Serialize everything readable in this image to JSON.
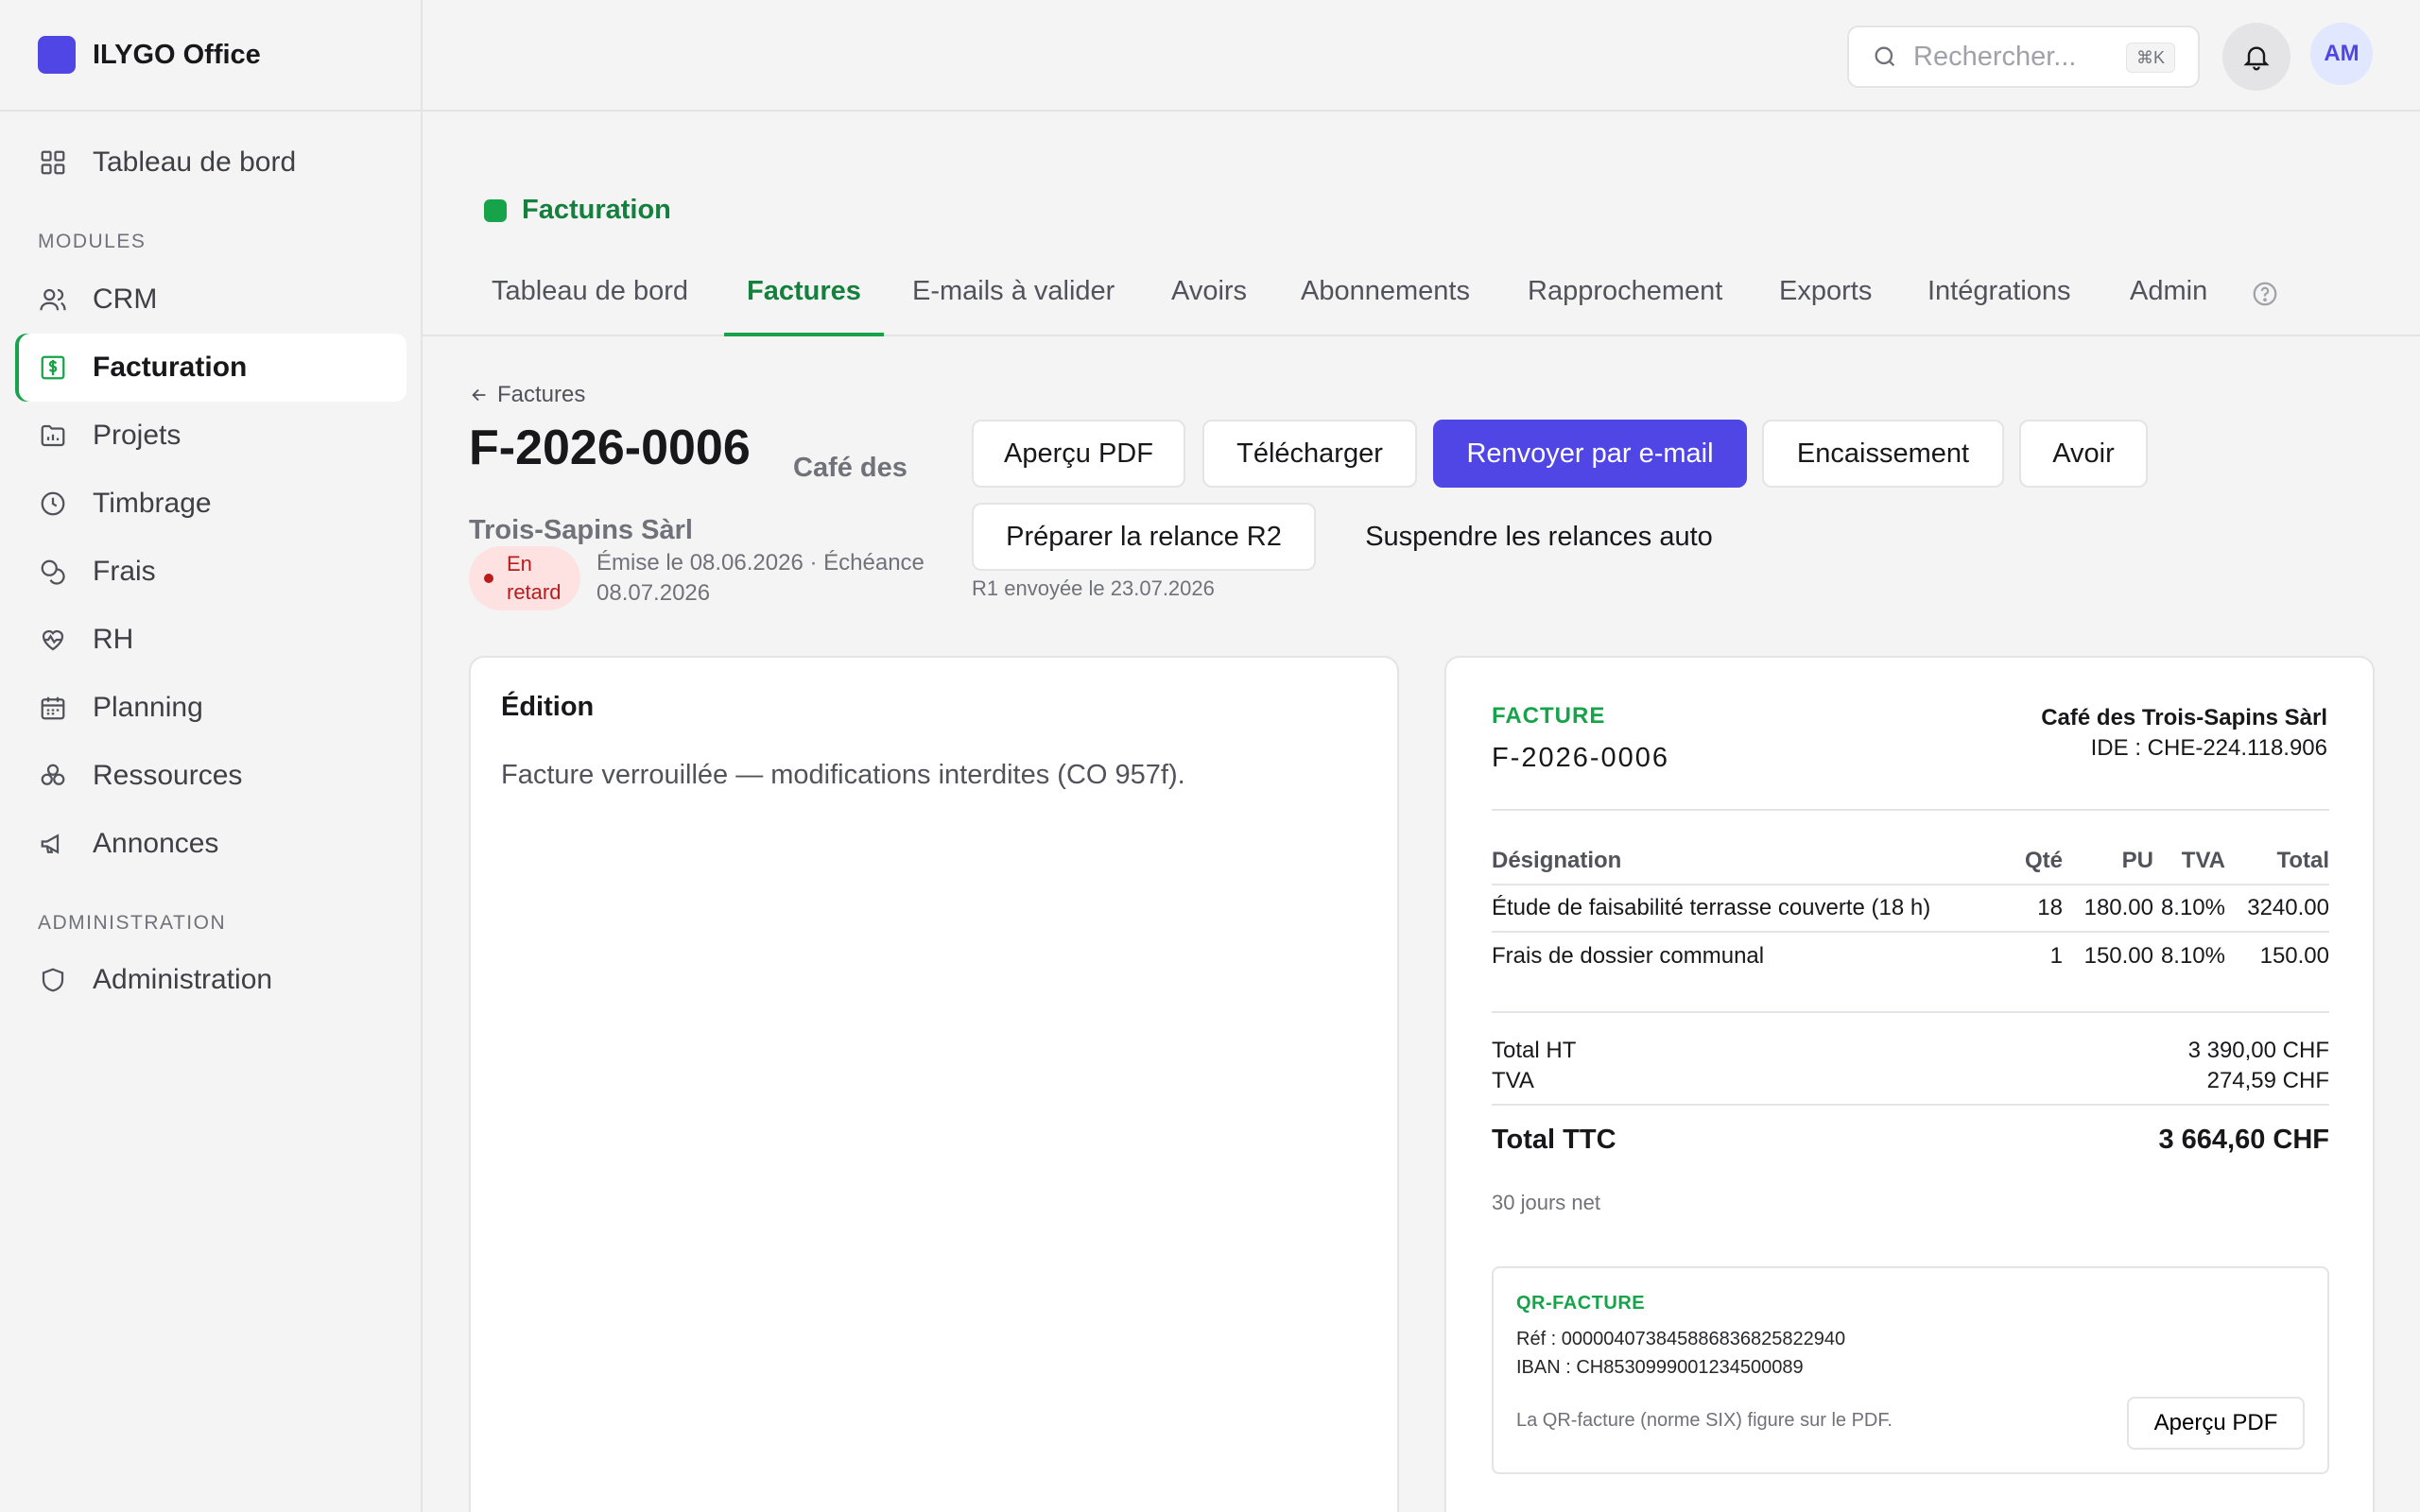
{
  "brand": {
    "name": "ILYGO Office",
    "color": "#4f46e5"
  },
  "sidebar": {
    "top_item": {
      "label": "Tableau de bord",
      "icon": "grid-icon"
    },
    "modules_label": "MODULES",
    "modules": [
      {
        "label": "CRM",
        "icon": "users-icon"
      },
      {
        "label": "Facturation",
        "icon": "invoice-icon",
        "active": true
      },
      {
        "label": "Projets",
        "icon": "folder-icon"
      },
      {
        "label": "Timbrage",
        "icon": "clock-icon"
      },
      {
        "label": "Frais",
        "icon": "coins-icon"
      },
      {
        "label": "RH",
        "icon": "heart-pulse-icon"
      },
      {
        "label": "Planning",
        "icon": "calendar-icon"
      },
      {
        "label": "Ressources",
        "icon": "boxes-icon"
      },
      {
        "label": "Annonces",
        "icon": "megaphone-icon"
      }
    ],
    "admin_label": "ADMINISTRATION",
    "admin_items": [
      {
        "label": "Administration",
        "icon": "shield-icon"
      }
    ]
  },
  "topbar": {
    "search_placeholder": "Rechercher...",
    "search_shortcut": "⌘K",
    "avatar_initials": "AM"
  },
  "module": {
    "title": "Facturation",
    "accent": "#16a34a"
  },
  "tabs": [
    "Tableau de bord",
    "Factures",
    "E-mails à valider",
    "Avoirs",
    "Abonnements",
    "Rapprochement",
    "Exports",
    "Intégrations",
    "Admin"
  ],
  "active_tab": "Factures",
  "invoice": {
    "back_label": "Factures",
    "number": "F-2026-0006",
    "client": "Café des Trois-Sapins Sàrl",
    "status": "En retard",
    "dates": "Émise le 08.06.2026 · Échéance 08.07.2026",
    "actions": {
      "preview_pdf": "Aperçu PDF",
      "download": "Télécharger",
      "resend_email": "Renvoyer par e-mail",
      "payment": "Encaissement",
      "credit_note": "Avoir",
      "prepare_reminder": "Préparer la relance R2",
      "suspend_reminders": "Suspendre les relances auto"
    },
    "reminder_note": "R1 envoyée le 23.07.2026"
  },
  "edition": {
    "title": "Édition",
    "message": "Facture verrouillée — modifications interdites (CO 957f)."
  },
  "preview": {
    "label": "FACTURE",
    "number": "F-2026-0006",
    "client_name": "Café des Trois-Sapins Sàrl",
    "client_ide": "IDE : CHE-224.118.906",
    "columns": [
      "Désignation",
      "Qté",
      "PU",
      "TVA",
      "Total"
    ],
    "rows": [
      [
        "Étude de faisabilité terrasse couverte (18 h)",
        "18",
        "180.00",
        "8.10%",
        "3240.00"
      ],
      [
        "Frais de dossier communal",
        "1",
        "150.00",
        "8.10%",
        "150.00"
      ]
    ],
    "total_ht_label": "Total HT",
    "total_ht": "3 390,00 CHF",
    "tva_label": "TVA",
    "tva": "274,59 CHF",
    "total_ttc_label": "Total TTC",
    "total_ttc": "3 664,60 CHF",
    "terms": "30 jours net",
    "qr": {
      "label": "QR-FACTURE",
      "ref": "Réf : 000004073845886836825822940",
      "iban": "IBAN : CH8530999001234500089",
      "note": "La QR-facture (norme SIX) figure sur le PDF.",
      "button": "Aperçu PDF"
    }
  }
}
